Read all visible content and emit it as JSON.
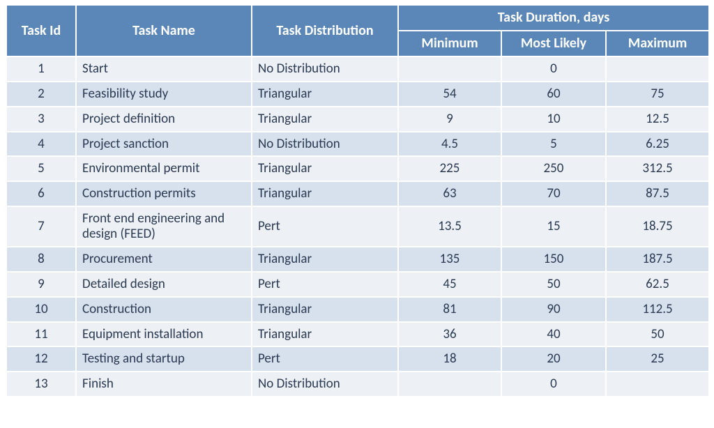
{
  "headers": {
    "task_id": "Task Id",
    "task_name": "Task Name",
    "task_distribution": "Task Distribution",
    "duration_group": "Task Duration, days",
    "minimum": "Minimum",
    "most_likely": "Most Likely",
    "maximum": "Maximum"
  },
  "chart_data": {
    "type": "table",
    "columns": [
      "Task Id",
      "Task Name",
      "Task Distribution",
      "Minimum",
      "Most Likely",
      "Maximum"
    ],
    "rows": [
      {
        "id": "1",
        "name": "Start",
        "dist": "No Distribution",
        "min": "",
        "most": "0",
        "max": ""
      },
      {
        "id": "2",
        "name": "Feasibility study",
        "dist": "Triangular",
        "min": "54",
        "most": "60",
        "max": "75"
      },
      {
        "id": "3",
        "name": "Project definition",
        "dist": "Triangular",
        "min": "9",
        "most": "10",
        "max": "12.5"
      },
      {
        "id": "4",
        "name": "Project sanction",
        "dist": "No Distribution",
        "min": "4.5",
        "most": "5",
        "max": "6.25"
      },
      {
        "id": "5",
        "name": "Environmental permit",
        "dist": "Triangular",
        "min": "225",
        "most": "250",
        "max": "312.5"
      },
      {
        "id": "6",
        "name": "Construction permits",
        "dist": "Triangular",
        "min": "63",
        "most": "70",
        "max": "87.5"
      },
      {
        "id": "7",
        "name": "Front end engineering and design (FEED)",
        "dist": "Pert",
        "min": "13.5",
        "most": "15",
        "max": "18.75"
      },
      {
        "id": "8",
        "name": "Procurement",
        "dist": "Triangular",
        "min": "135",
        "most": "150",
        "max": "187.5"
      },
      {
        "id": "9",
        "name": "Detailed design",
        "dist": "Pert",
        "min": "45",
        "most": "50",
        "max": "62.5"
      },
      {
        "id": "10",
        "name": "Construction",
        "dist": "Triangular",
        "min": "81",
        "most": "90",
        "max": "112.5"
      },
      {
        "id": "11",
        "name": "Equipment installation",
        "dist": "Triangular",
        "min": "36",
        "most": "40",
        "max": "50"
      },
      {
        "id": "12",
        "name": "Testing and startup",
        "dist": "Pert",
        "min": "18",
        "most": "20",
        "max": "25"
      },
      {
        "id": "13",
        "name": "Finish",
        "dist": "No Distribution",
        "min": "",
        "most": "0",
        "max": ""
      }
    ]
  }
}
